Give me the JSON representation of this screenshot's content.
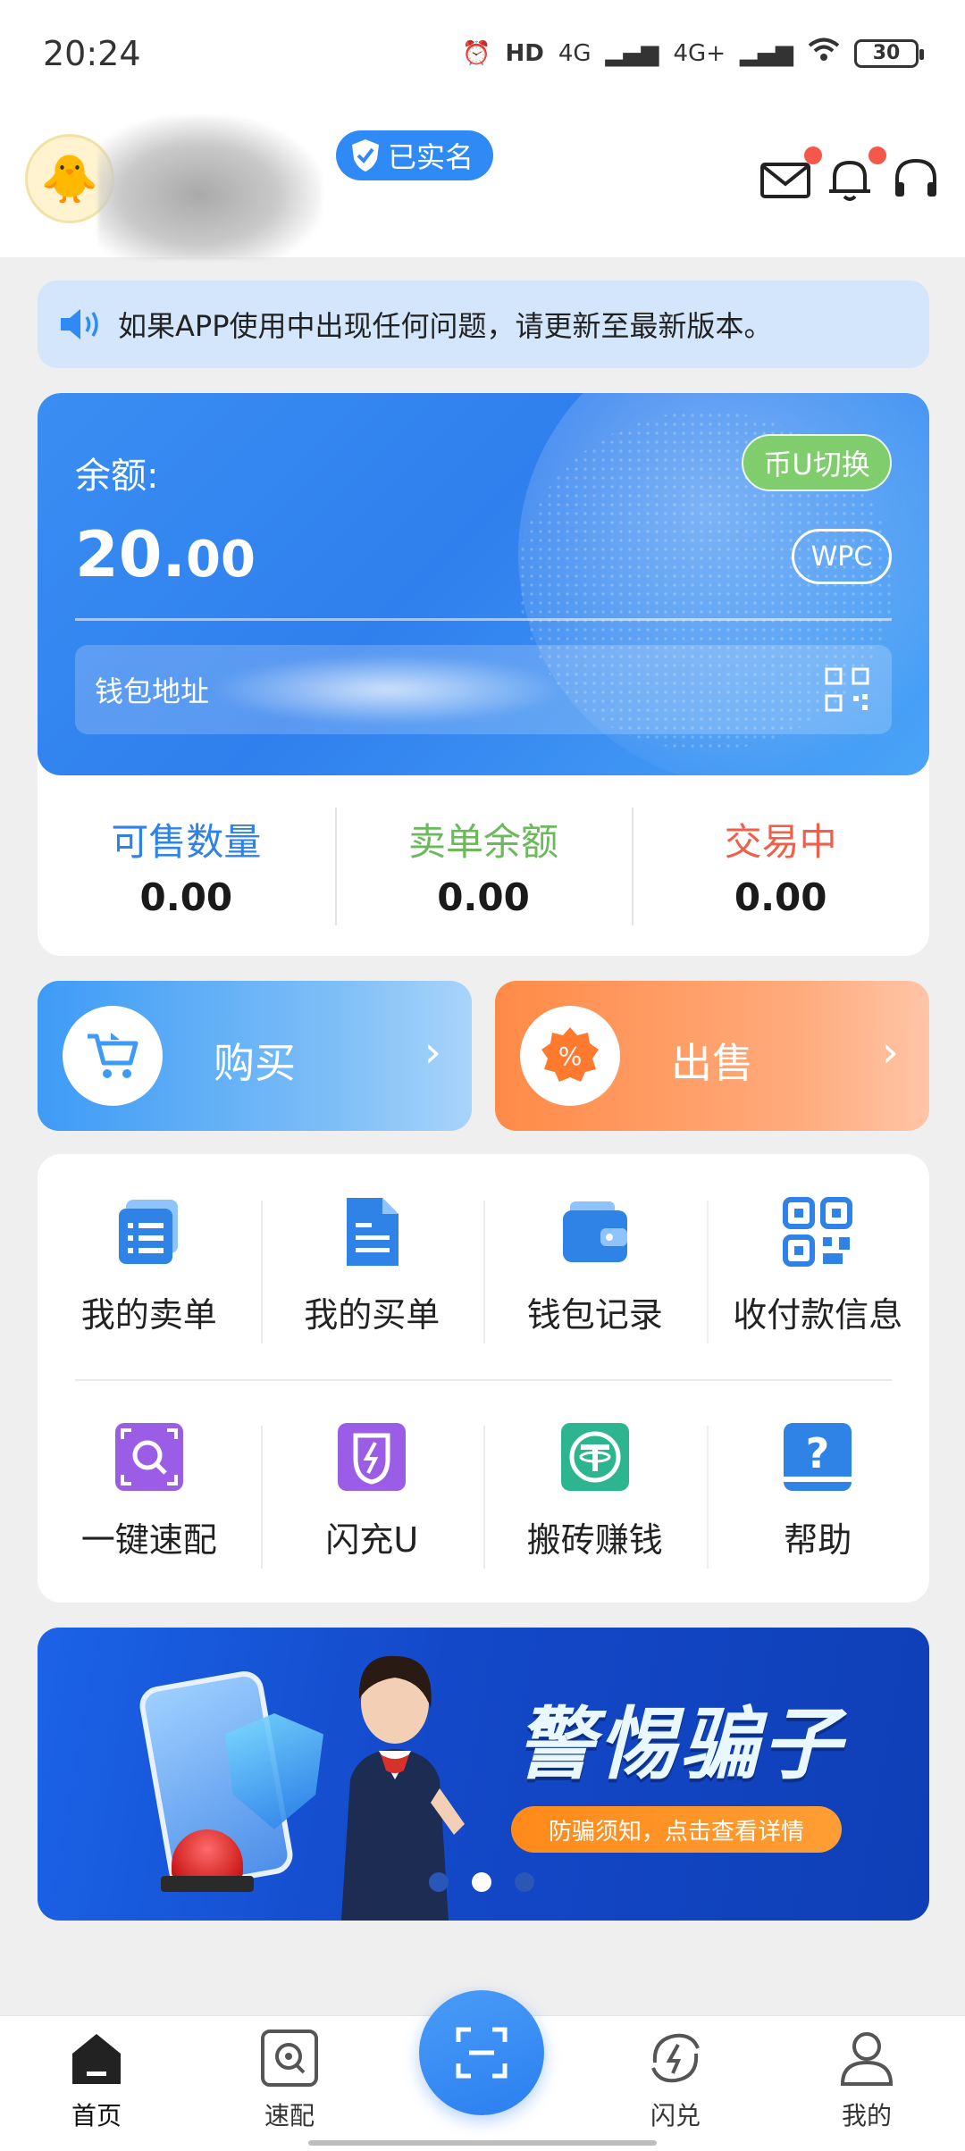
{
  "status_bar": {
    "time": "20:24",
    "network_1": "4G",
    "network_2": "4G+",
    "battery": "30",
    "hd": "HD"
  },
  "header": {
    "verified_label": "已实名"
  },
  "notice": {
    "text": "如果APP使用中出现任何问题，请更新至最新版本。"
  },
  "balance": {
    "label": "余额:",
    "value_int": "20.",
    "value_dec": "00",
    "switch_label": "币U切换",
    "currency": "WPC",
    "address_label": "钱包地址"
  },
  "stats": [
    {
      "label": "可售数量",
      "value": "0.00",
      "color": "#2f82e6"
    },
    {
      "label": "卖单余额",
      "value": "0.00",
      "color": "#6bb95a"
    },
    {
      "label": "交易中",
      "value": "0.00",
      "color": "#ef5f4a"
    }
  ],
  "trade": {
    "buy_label": "购买",
    "sell_label": "出售"
  },
  "menu": {
    "row1": [
      "我的卖单",
      "我的买单",
      "钱包记录",
      "收付款信息"
    ],
    "row2": [
      "一键速配",
      "闪充U",
      "搬砖赚钱",
      "帮助"
    ]
  },
  "banner": {
    "title": "警惕骗子",
    "subtitle": "防骗须知，点击查看详情"
  },
  "nav": {
    "home": "首页",
    "match": "速配",
    "flash": "闪兑",
    "mine": "我的"
  },
  "colors": {
    "primary": "#2f8af5",
    "sell": "#ff8a47",
    "switch": "#7fcd6c"
  }
}
